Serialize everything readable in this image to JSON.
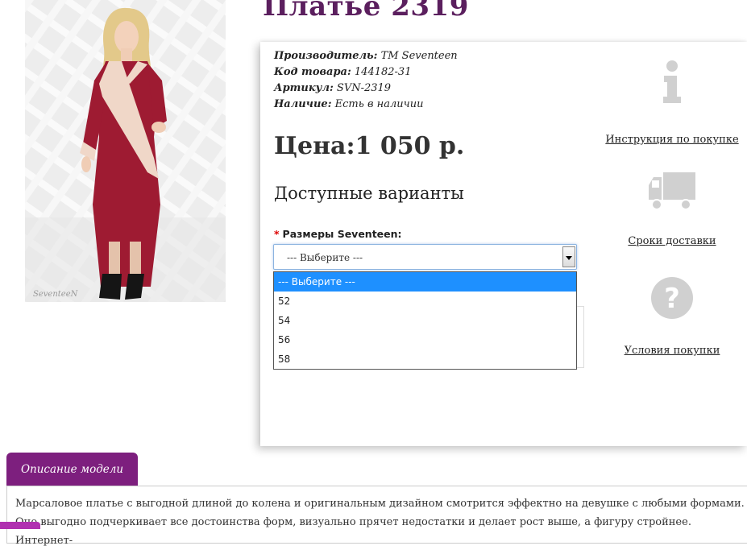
{
  "product": {
    "title": "Платье 2319",
    "specs": [
      {
        "label": "Производитель:",
        "value": "TM Seventeen"
      },
      {
        "label": "Код товара:",
        "value": "144182-31"
      },
      {
        "label": "Артикул:",
        "value": "SVN-2319"
      },
      {
        "label": "Наличие:",
        "value": "Есть в наличии"
      }
    ],
    "price": "Цена:1 050 р.",
    "variants_heading": "Доступные варианты",
    "photo_watermark": "SeventeeN"
  },
  "size_select": {
    "required_mark": "*",
    "label": "Размеры Seventeen:",
    "selected": "--- Выберите ---",
    "options": [
      "--- Выберите ---",
      "52",
      "54",
      "56",
      "58"
    ]
  },
  "sidebar": {
    "instructions": {
      "label": "Инструкция по покупке",
      "icon": "info-icon"
    },
    "delivery": {
      "label": "Сроки доставки",
      "icon": "truck-icon"
    },
    "conditions": {
      "label": "Условия покупки",
      "icon": "question-icon"
    }
  },
  "description": {
    "tab_label": "Описание модели",
    "text": "Марсаловое платье с выгодной длиной до колена и оригинальным дизайном смотрится эффектно на девушке с любыми формами. Оно выгодно подчеркивает все достоинства форм, визуально прячет недостатки и делает рост выше, а фигуру стройнее. Интернет-"
  },
  "colors": {
    "title": "#5b1f5e",
    "tab": "#7d1f7e",
    "dress": "#9e1b32",
    "accent_stripe": "#f0d7c8",
    "dropdown_highlight": "#1e90ff",
    "icon_gray": "#d0d0d0"
  }
}
